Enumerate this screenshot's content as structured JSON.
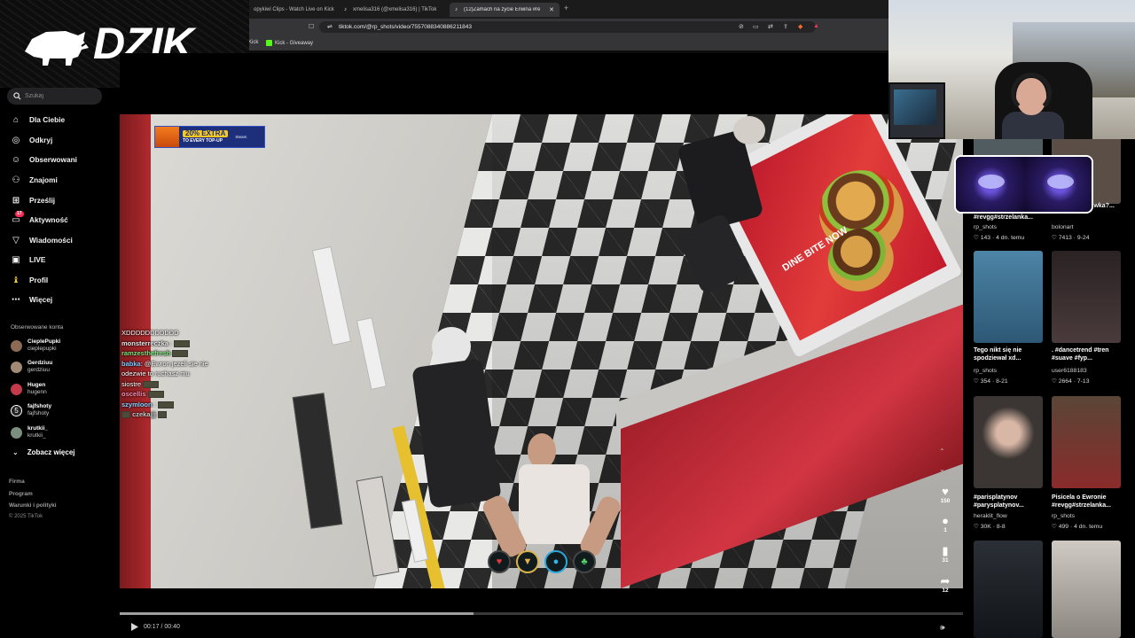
{
  "overlay": {
    "brand": "DZIK",
    "reg": "®"
  },
  "browser": {
    "tabs": [
      {
        "label": "opykiwi Clips - Watch Live on Kick",
        "active": false
      },
      {
        "label": "xmelisa316 (@xmelisa316) | TikTok",
        "active": false
      },
      {
        "label": "(12)Zamach na życie Erwina #re",
        "active": true
      }
    ],
    "new_tab": "+",
    "url": "tiktok.com/@rp_shots/video/7557088340886211843",
    "bookmarks": [
      {
        "label": "Kick"
      },
      {
        "label": "Kick - Giveaway"
      }
    ]
  },
  "sidebar": {
    "search_placeholder": "Szukaj",
    "nav": [
      {
        "label": "Dla Ciebie",
        "icon": "home-icon"
      },
      {
        "label": "Odkryj",
        "icon": "compass-icon"
      },
      {
        "label": "Obserwowani",
        "icon": "user-plus-icon"
      },
      {
        "label": "Znajomi",
        "icon": "friends-icon"
      },
      {
        "label": "Prześlij",
        "icon": "upload-icon"
      },
      {
        "label": "Aktywność",
        "icon": "inbox-icon",
        "badge": "17"
      },
      {
        "label": "Wiadomości",
        "icon": "send-icon"
      },
      {
        "label": "LIVE",
        "icon": "live-icon"
      },
      {
        "label": "Profil",
        "icon": "profile-icon"
      },
      {
        "label": "Więcej",
        "icon": "more-icon"
      }
    ],
    "following_heading": "Obserwowane konta",
    "accounts": [
      {
        "name": "CieplePupki",
        "handle": "cieplepupki",
        "color": "#8b6b55"
      },
      {
        "name": "Gerdziuu",
        "handle": "gerdziuu",
        "color": "#a38a74"
      },
      {
        "name": "Hugen",
        "handle": "hugenn",
        "color": "#c43a4a"
      },
      {
        "name": "fajfshoty",
        "handle": "fajfshoty",
        "color": "#222222"
      },
      {
        "name": "krutkii_",
        "handle": "krutkii_",
        "color": "#7a8f7e"
      }
    ],
    "see_more": "Zobacz więcej",
    "footer": [
      "Firma",
      "Program",
      "Warunki i polityki"
    ],
    "copyright": "© 2025 TikTok"
  },
  "video": {
    "promo": {
      "percent": "20% EXTRA",
      "sub": "TO EVERY TOP-UP",
      "brand": "Steam"
    },
    "chat": [
      {
        "name": "",
        "text": "XDDDDDDDDDDD",
        "color": "#ffffff",
        "emote": false
      },
      {
        "name": "monsterreczka",
        "text": ":",
        "color": "#e7e7e7",
        "emote": true
      },
      {
        "name": "ramzesthefresh",
        "text": "",
        "color": "#7ee07c",
        "emote": true
      },
      {
        "name": "babka",
        "text": ": @Ewron jezeli sie nie",
        "color": "#7ec9ff",
        "emote": false
      },
      {
        "name": "",
        "text": "odezwie to ruchasz mu",
        "color": "#ffffff",
        "emote": false
      },
      {
        "name": "",
        "text": "siostre",
        "color": "#ffffff",
        "emote": true
      },
      {
        "name": "oscellis",
        "text": "",
        "color": "#ff8fb2",
        "emote": true
      },
      {
        "name": "szymloon",
        "text": ":",
        "color": "#8fd0ff",
        "emote": true
      },
      {
        "name": "czekajjj",
        "text": "",
        "color": "#c9c9c9",
        "emote": true
      }
    ],
    "ad_text": "DINE BITE NOW",
    "time": "00:17 / 00:40",
    "progress": 0.42,
    "actions": [
      {
        "icon": "heart-icon",
        "count": "150"
      },
      {
        "icon": "comment-icon",
        "count": "1"
      },
      {
        "icon": "bookmark-icon",
        "count": "31"
      },
      {
        "icon": "share-icon",
        "count": "12"
      }
    ]
  },
  "rail": {
    "cards": [
      {
        "title": "#revgg#strzelanka...",
        "author": "rp_shots",
        "meta": "143 · 4 dn. temu",
        "bg": "#515c61"
      },
      {
        "title": "...jesz bez folowka?...",
        "author": "bolonart",
        "meta": "7413 · 9-24",
        "bg": "#5b4e46"
      },
      {
        "title": "Tego nikt się nie spodziewał xd...",
        "author": "rp_shots",
        "meta": "354 · 8-21",
        "bg": "#3b6b86"
      },
      {
        "title": ". #dancetrend #tren #suave #fyp...",
        "author": "user6188183",
        "meta": "2664 · 7-13",
        "bg": "#2a2223"
      },
      {
        "title": "#parisplatynov #parysplatynov...",
        "author": "heraklit_flow",
        "meta": "30K · 8-8",
        "bg": "#3b3634"
      },
      {
        "title": "Pisicela o Ewronie #revgg#strzelanka...",
        "author": "rp_shots",
        "meta": "499 · 4 dn. temu",
        "bg": "#4a3a2f"
      },
      {
        "title": "",
        "author": "",
        "meta": "",
        "bg": "#1b1f24"
      },
      {
        "title": "",
        "author": "",
        "meta": "",
        "bg": "#b9b4ae"
      }
    ]
  }
}
